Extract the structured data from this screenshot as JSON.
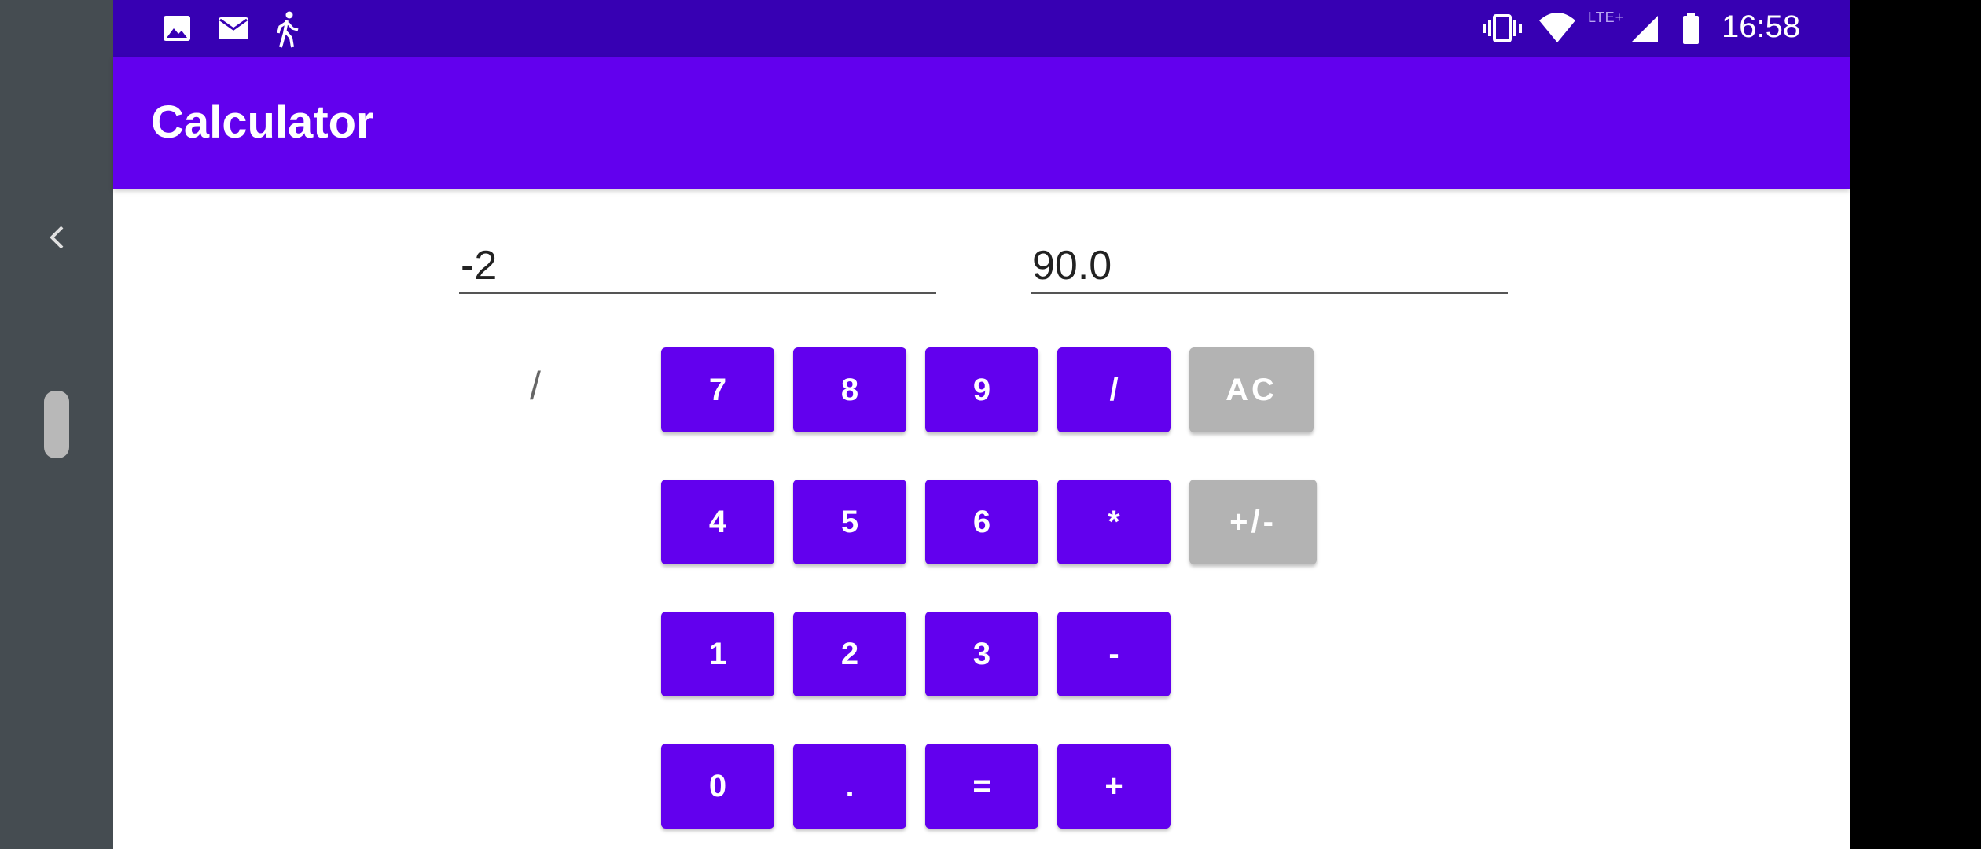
{
  "status_bar": {
    "time": "16:58",
    "network_label": "LTE+",
    "left_icons": [
      "image-icon",
      "mail-icon",
      "walking-icon"
    ],
    "right_icons": [
      "vibrate-icon",
      "wifi-icon",
      "signal-icon",
      "battery-icon"
    ]
  },
  "app_bar": {
    "title": "Calculator"
  },
  "inputs": {
    "first_operand": "-2",
    "second_operand": "90.0"
  },
  "operator_display": "/",
  "keypad": {
    "row1": [
      "7",
      "8",
      "9",
      "/",
      "AC"
    ],
    "row2": [
      "4",
      "5",
      "6",
      "*",
      "+/-"
    ],
    "row3": [
      "1",
      "2",
      "3",
      "-"
    ],
    "row4": [
      "0",
      ".",
      "=",
      "+"
    ]
  },
  "colors": {
    "primary": "#6200ee",
    "primary_dark": "#3700b3",
    "secondary_button": "#b3b3b3"
  }
}
